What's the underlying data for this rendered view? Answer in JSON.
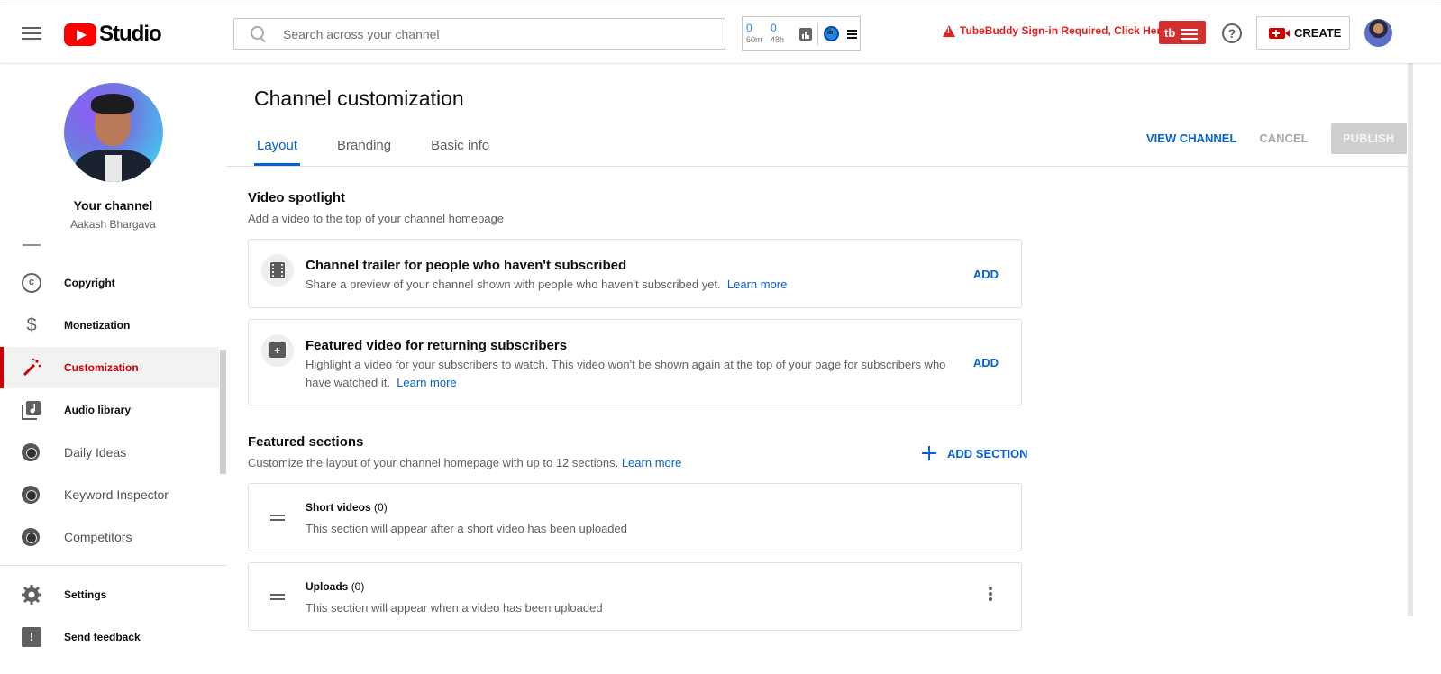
{
  "header": {
    "logo_text": "Studio",
    "search_placeholder": "Search across your channel",
    "tubebuddy": {
      "stat1_value": "0",
      "stat1_label": "60m",
      "stat2_value": "0",
      "stat2_label": "48h",
      "warning": "TubeBuddy Sign-in Required, Click Here",
      "logo_text": "tb"
    },
    "help_symbol": "?",
    "create_label": "CREATE"
  },
  "sidebar": {
    "channel_label": "Your channel",
    "channel_name": "Aakash Bhargava",
    "items": [
      {
        "label": "Copyright",
        "icon": "copyright-icon"
      },
      {
        "label": "Monetization",
        "icon": "dollar-icon"
      },
      {
        "label": "Customization",
        "icon": "magic-wand-icon",
        "active": true
      },
      {
        "label": "Audio library",
        "icon": "audio-library-icon"
      },
      {
        "label": "Daily Ideas",
        "icon": "tubebuddy-icon"
      },
      {
        "label": "Keyword Inspector",
        "icon": "tubebuddy-icon"
      },
      {
        "label": "Competitors",
        "icon": "tubebuddy-icon"
      },
      {
        "label": "Settings",
        "icon": "gear-icon"
      },
      {
        "label": "Send feedback",
        "icon": "feedback-icon"
      }
    ]
  },
  "main": {
    "title": "Channel customization",
    "tabs": [
      {
        "label": "Layout",
        "active": true
      },
      {
        "label": "Branding"
      },
      {
        "label": "Basic info"
      }
    ],
    "actions": {
      "view_channel": "VIEW CHANNEL",
      "cancel": "CANCEL",
      "publish": "PUBLISH"
    },
    "video_spotlight": {
      "title": "Video spotlight",
      "subtitle": "Add a video to the top of your channel homepage",
      "cards": [
        {
          "title": "Channel trailer for people who haven't subscribed",
          "desc": "Share a preview of your channel shown with people who haven't subscribed yet.",
          "learn_more": "Learn more",
          "add": "ADD"
        },
        {
          "title": "Featured video for returning subscribers",
          "desc": "Highlight a video for your subscribers to watch. This video won't be shown again at the top of your page for subscribers who have watched it.",
          "learn_more": "Learn more",
          "add": "ADD"
        }
      ]
    },
    "featured_sections": {
      "title": "Featured sections",
      "subtitle": "Customize the layout of your channel homepage with up to 12 sections.",
      "learn_more": "Learn more",
      "add_section": "ADD SECTION",
      "sections": [
        {
          "title": "Short videos",
          "count": "(0)",
          "desc": "This section will appear after a short video has been uploaded"
        },
        {
          "title": "Uploads",
          "count": "(0)",
          "desc": "This section will appear when a video has been uploaded"
        }
      ]
    }
  }
}
